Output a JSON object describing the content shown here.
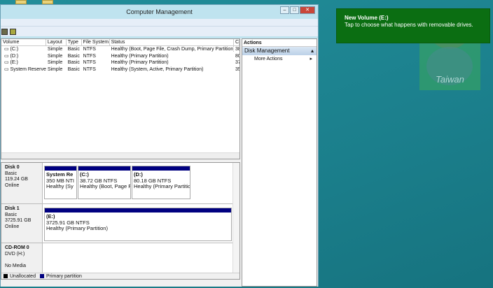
{
  "window": {
    "title": "Computer Management",
    "controls": [
      "minimize",
      "restore",
      "close"
    ]
  },
  "table": {
    "headers": [
      "Volume",
      "Layout",
      "Type",
      "File System",
      "Status",
      "C"
    ],
    "rows": [
      [
        "(C:)",
        "Simple",
        "Basic",
        "NTFS",
        "Healthy (Boot, Page File, Crash Dump, Primary Partition)",
        "38"
      ],
      [
        "(D:)",
        "Simple",
        "Basic",
        "NTFS",
        "Healthy (Primary Partition)",
        "80"
      ],
      [
        "(E:)",
        "Simple",
        "Basic",
        "NTFS",
        "Healthy (Primary Partition)",
        "37"
      ],
      [
        "System Reserved",
        "Simple",
        "Basic",
        "NTFS",
        "Healthy (System, Active, Primary Partition)",
        "35"
      ]
    ]
  },
  "disks": [
    {
      "name": "Disk 0",
      "type": "Basic",
      "size": "119.24 GB",
      "state": "Online",
      "partitions": [
        {
          "name": "System Re",
          "size": "350 MB NTI",
          "status": "Healthy (Sy"
        },
        {
          "name": "(C:)",
          "size": "38.72 GB NTFS",
          "status": "Healthy (Boot, Page Fil"
        },
        {
          "name": "(D:)",
          "size": "80.18 GB NTFS",
          "status": "Healthy (Primary Partitior"
        }
      ]
    },
    {
      "name": "Disk 1",
      "type": "Basic",
      "size": "3725.91 GB",
      "state": "Online",
      "partitions": [
        {
          "name": "(E:)",
          "size": "3725.91 GB NTFS",
          "status": "Healthy (Primary Partition)"
        }
      ]
    },
    {
      "name": "CD-ROM 0",
      "type": "DVD (H:)",
      "state": "No Media"
    }
  ],
  "legend": [
    {
      "label": "Unallocated",
      "color": "#000000"
    },
    {
      "label": "Primary partition",
      "color": "#000080"
    }
  ],
  "actions": {
    "title": "Actions",
    "section": "Disk Management",
    "items": [
      "More Actions"
    ]
  },
  "toast": {
    "title": "New Volume (E:)",
    "message": "Tap to choose what happens with removable drives."
  },
  "watermark": {
    "text": "Taiwan"
  }
}
